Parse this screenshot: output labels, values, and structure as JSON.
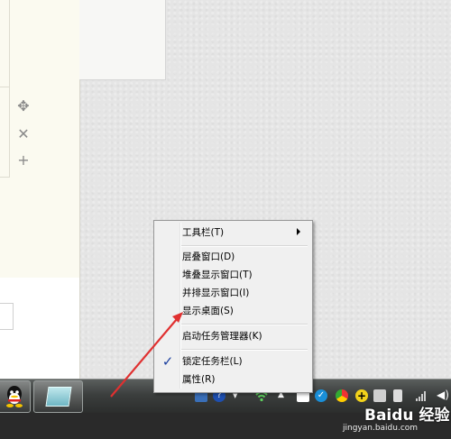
{
  "menu": {
    "items": {
      "toolbar": "工具栏(T)",
      "cascade": "层叠窗口(D)",
      "stack": "堆叠显示窗口(T)",
      "side_by_side": "并排显示窗口(I)",
      "show_desktop": "显示桌面(S)",
      "task_manager": "启动任务管理器(K)",
      "lock_taskbar": "锁定任务栏(L)",
      "properties": "属性(R)"
    },
    "lock_taskbar_checked": true
  },
  "taskbar": {
    "buttons": [
      "qq-icon",
      "app-window-icon"
    ],
    "tray_icons": [
      "shield-icon",
      "help-icon",
      "network-wifi-icon",
      "show-hidden-arrow-icon",
      "windows-icon",
      "check-icon",
      "chrome-icon",
      "plus-icon",
      "gamepad-icon",
      "battery-icon",
      "signal-icon",
      "volume-icon"
    ]
  },
  "watermark": {
    "title": "Baidu 经验",
    "url": "jingyan.baidu.com"
  },
  "colors": {
    "annotation_arrow": "#e03030",
    "check_mark": "#1b3f9f"
  }
}
